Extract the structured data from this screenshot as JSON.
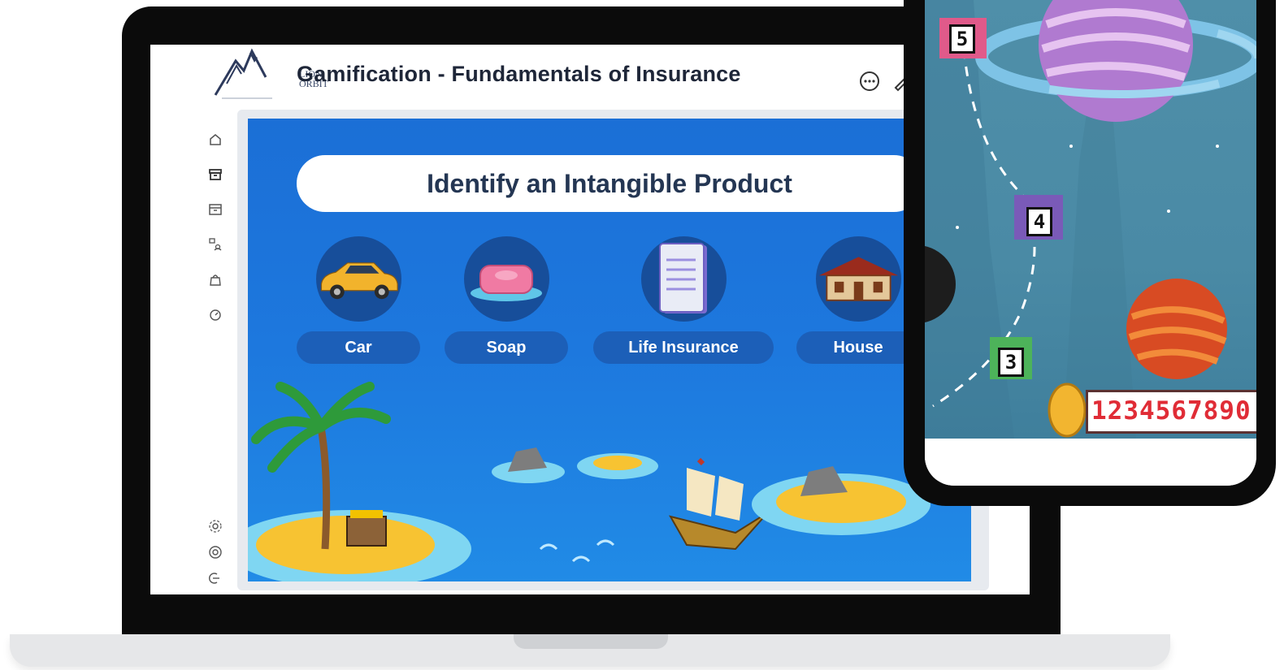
{
  "app": {
    "title": "Gamification - Fundamentals of Insurance",
    "logo_line1": "LION",
    "logo_line2": "ORBIT"
  },
  "header_icons": [
    "chat-icon",
    "pen-icon"
  ],
  "sidebar": {
    "items": [
      {
        "icon": "home-icon"
      },
      {
        "icon": "archive-icon"
      },
      {
        "icon": "inbox-icon"
      },
      {
        "icon": "users-switch-icon"
      },
      {
        "icon": "bag-icon"
      },
      {
        "icon": "dashboard-icon"
      }
    ],
    "bottom": [
      {
        "icon": "settings-icon"
      },
      {
        "icon": "help-icon"
      },
      {
        "icon": "logout-icon"
      }
    ]
  },
  "game": {
    "question": "Identify an Intangible Product",
    "options": [
      {
        "label": "Car",
        "icon": "car-icon"
      },
      {
        "label": "Soap",
        "icon": "soap-icon"
      },
      {
        "label": "Life Insurance",
        "icon": "document-icon"
      },
      {
        "label": "House",
        "icon": "house-icon"
      }
    ]
  },
  "phone": {
    "levels": [
      "5",
      "4",
      "3"
    ],
    "score": "1234567890"
  },
  "colors": {
    "game_bg": "#1d78de",
    "pill": "#1c5fb8",
    "circle": "#174e9a",
    "title": "#1e2638",
    "space_bg": "#4a8aa5",
    "score": "#e02c36"
  }
}
